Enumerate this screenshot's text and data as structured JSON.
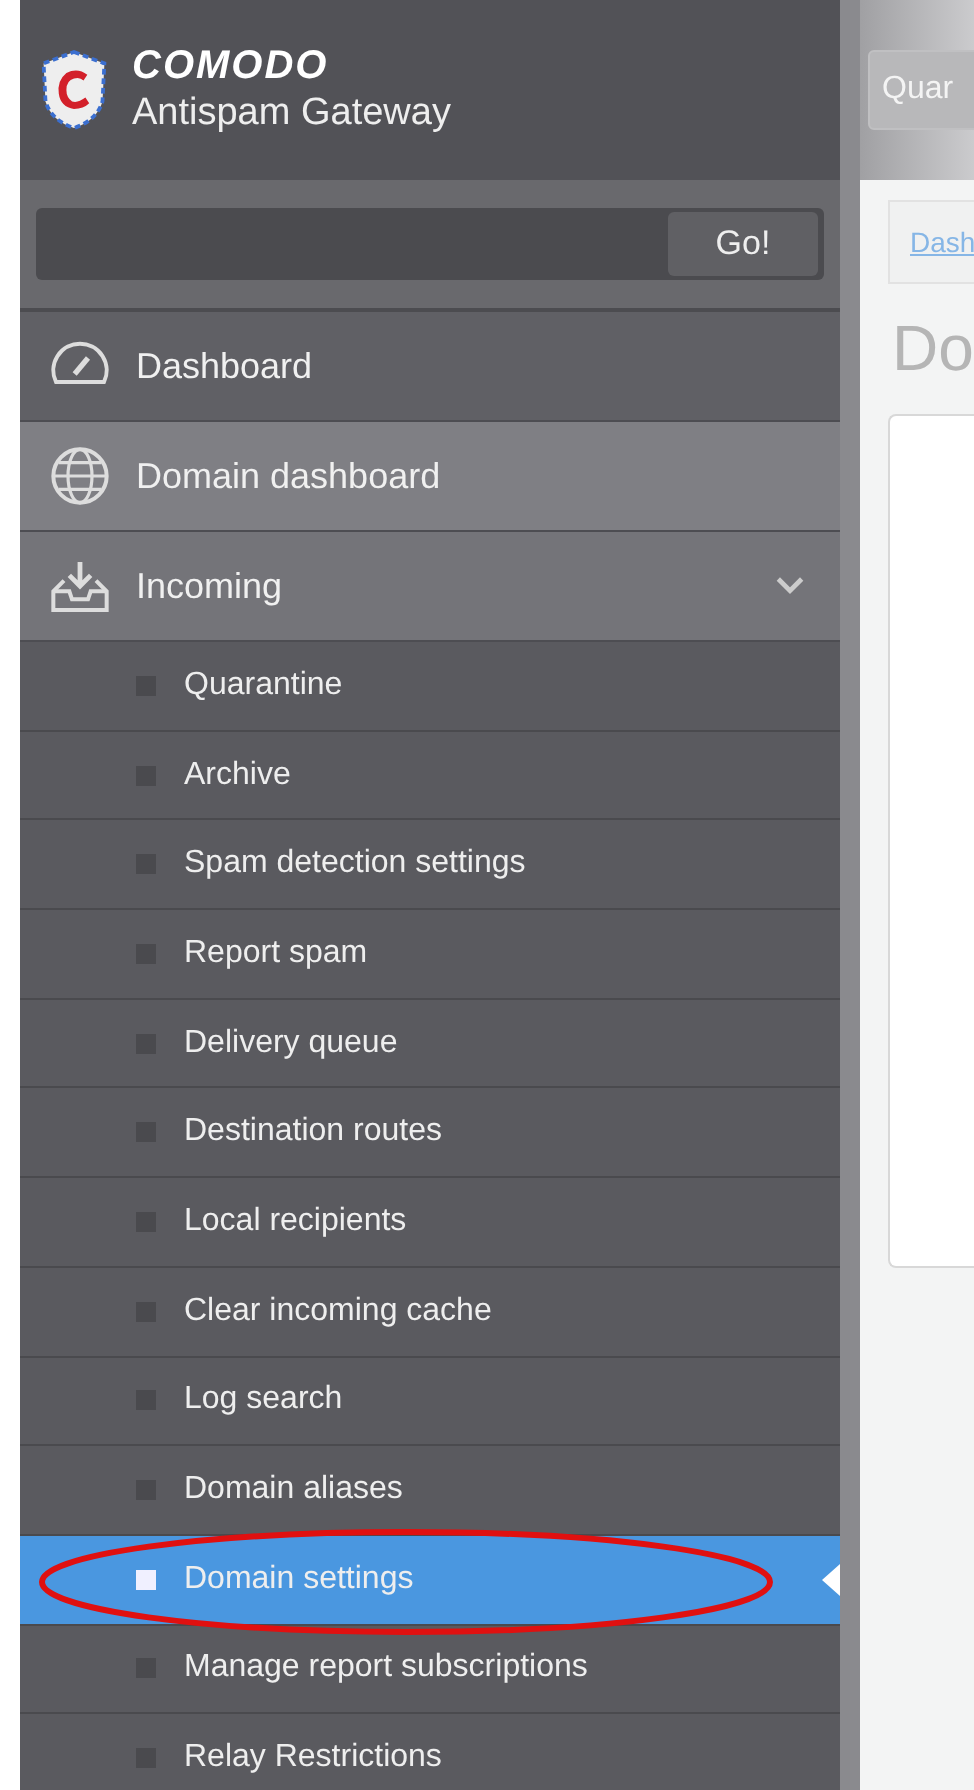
{
  "header": {
    "brand": "COMODO",
    "product": "Antispam Gateway",
    "top_button": "Quar"
  },
  "search": {
    "button": "Go!"
  },
  "nav": [
    {
      "label": "Dashboard",
      "selected": false
    },
    {
      "label": "Domain dashboard",
      "selected": false
    },
    {
      "label": "Incoming",
      "selected": false,
      "expanded": true,
      "children": [
        {
          "label": "Quarantine",
          "selected": false
        },
        {
          "label": "Archive",
          "selected": false
        },
        {
          "label": "Spam detection settings",
          "selected": false
        },
        {
          "label": "Report spam",
          "selected": false
        },
        {
          "label": "Delivery queue",
          "selected": false
        },
        {
          "label": "Destination routes",
          "selected": false
        },
        {
          "label": "Local recipients",
          "selected": false
        },
        {
          "label": "Clear incoming cache",
          "selected": false
        },
        {
          "label": "Log search",
          "selected": false
        },
        {
          "label": "Domain aliases",
          "selected": false
        },
        {
          "label": "Domain settings",
          "selected": true
        },
        {
          "label": "Manage report subscriptions",
          "selected": false
        },
        {
          "label": "Relay Restrictions",
          "selected": false
        }
      ]
    }
  ],
  "main": {
    "breadcrumb": "Dash",
    "page_title": "Do"
  }
}
